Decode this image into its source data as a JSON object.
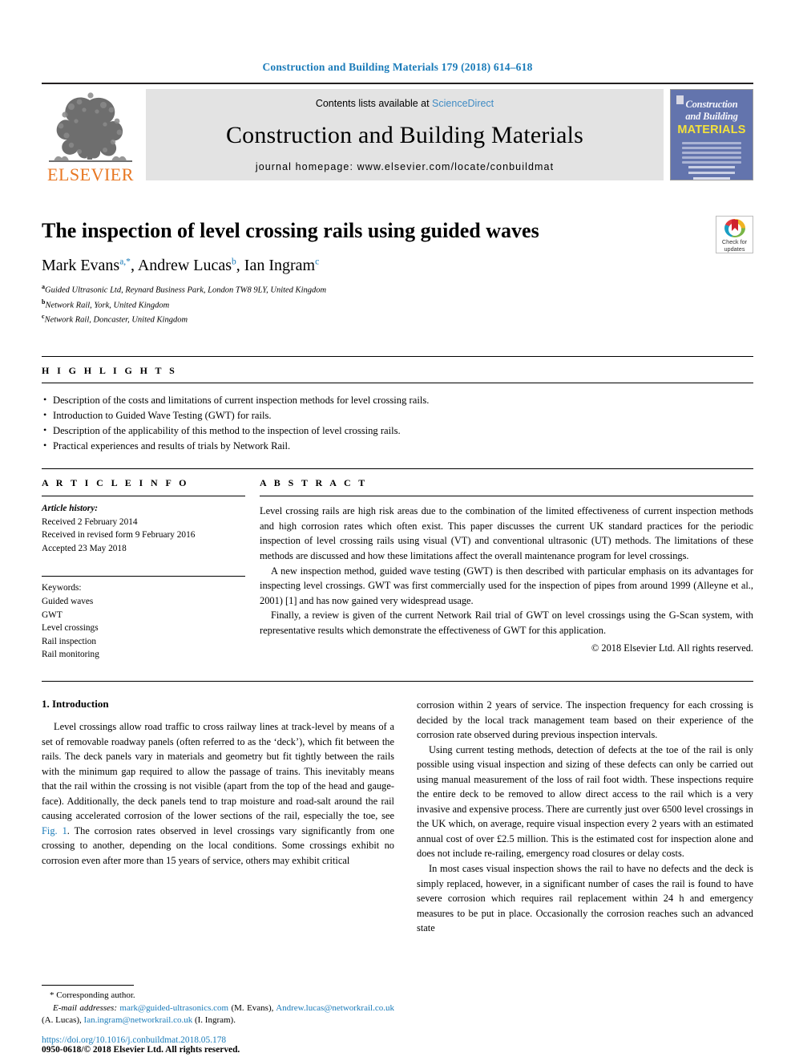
{
  "running_head": "Construction and Building Materials 179 (2018) 614–618",
  "masthead": {
    "publisher": "ELSEVIER",
    "contents_prefix": "Contents lists available at ",
    "contents_link": "ScienceDirect",
    "journal_title": "Construction and Building Materials",
    "homepage_label": "journal homepage: www.elsevier.com/locate/conbuildmat",
    "cover": {
      "line1": "Construction",
      "line2": "and Building",
      "line3": "MATERIALS"
    }
  },
  "article": {
    "title": "The inspection of level crossing rails using guided waves",
    "authors": [
      {
        "name": "Mark Evans",
        "sup": "a,*"
      },
      {
        "name": "Andrew Lucas",
        "sup": "b"
      },
      {
        "name": "Ian Ingram",
        "sup": "c"
      }
    ],
    "affiliations": [
      {
        "sup": "a",
        "text": "Guided Ultrasonic Ltd, Reynard Business Park, London TW8 9LY, United Kingdom"
      },
      {
        "sup": "b",
        "text": "Network Rail, York, United Kingdom"
      },
      {
        "sup": "c",
        "text": "Network Rail, Doncaster, United Kingdom"
      }
    ],
    "crossmark": {
      "line1": "Check for",
      "line2": "updates"
    }
  },
  "highlights": {
    "label": "H I G H L I G H T S",
    "items": [
      "Description of the costs and limitations of current inspection methods for level crossing rails.",
      "Introduction to Guided Wave Testing (GWT) for rails.",
      "Description of the applicability of this method to the inspection of level crossing rails.",
      "Practical experiences and results of trials by Network Rail."
    ]
  },
  "article_info": {
    "label": "A R T I C L E   I N F O",
    "history_label": "Article history:",
    "history": [
      "Received 2 February 2014",
      "Received in revised form 9 February 2016",
      "Accepted 23 May 2018"
    ],
    "keywords_label": "Keywords:",
    "keywords": [
      "Guided waves",
      "GWT",
      "Level crossings",
      "Rail inspection",
      "Rail monitoring"
    ]
  },
  "abstract": {
    "label": "A B S T R A C T",
    "paragraphs": [
      "Level crossing rails are high risk areas due to the combination of the limited effectiveness of current inspection methods and high corrosion rates which often exist. This paper discusses the current UK standard practices for the periodic inspection of level crossing rails using visual (VT) and conventional ultrasonic (UT) methods. The limitations of these methods are discussed and how these limitations affect the overall maintenance program for level crossings.",
      "A new inspection method, guided wave testing (GWT) is then described with particular emphasis on its advantages for inspecting level crossings. GWT was first commercially used for the inspection of pipes from around 1999 (Alleyne et al., 2001) [1] and has now gained very widespread usage.",
      "Finally, a review is given of the current Network Rail trial of GWT on level crossings using the G-Scan system, with representative results which demonstrate the effectiveness of GWT for this application."
    ],
    "copyright": "© 2018 Elsevier Ltd. All rights reserved."
  },
  "body": {
    "section_heading": "1. Introduction",
    "left_paragraphs": [
      "Level crossings allow road traffic to cross railway lines at track-level by means of a set of removable roadway panels (often referred to as the ‘deck’), which fit between the rails. The deck panels vary in materials and geometry but fit tightly between the rails with the minimum gap required to allow the passage of trains. This inevitably means that the rail within the crossing is not visible (apart from the top of the head and gauge-face). Additionally, the deck panels tend to trap moisture and road-salt around the rail causing accelerated corrosion of the lower sections of the rail, especially the toe, see "
    ],
    "left_link": "Fig. 1",
    "left_paragraph_tail": ". The corrosion rates observed in level crossings vary significantly from one crossing to another, depending on the local conditions. Some crossings exhibit no corrosion even after more than 15 years of service, others may exhibit critical",
    "right_paragraphs": [
      "corrosion within 2 years of service. The inspection frequency for each crossing is decided by the local track management team based on their experience of the corrosion rate observed during previous inspection intervals.",
      "Using current testing methods, detection of defects at the toe of the rail is only possible using visual inspection and sizing of these defects can only be carried out using manual measurement of the loss of rail foot width. These inspections require the entire deck to be removed to allow direct access to the rail which is a very invasive and expensive process. There are currently just over 6500 level crossings in the UK which, on average, require visual inspection every 2 years with an estimated annual cost of over £2.5 million. This is the estimated cost for inspection alone and does not include re-railing, emergency road closures or delay costs.",
      "In most cases visual inspection shows the rail to have no defects and the deck is simply replaced, however, in a significant number of cases the rail is found to have severe corrosion which requires rail replacement within 24 h and emergency measures to be put in place. Occasionally the corrosion reaches such an advanced state"
    ]
  },
  "footnote": {
    "corresponding": "* Corresponding author.",
    "email_label": "E-mail addresses:",
    "emails": [
      {
        "address": "mark@guided-ultrasonics.com",
        "owner": "(M. Evans)"
      },
      {
        "address": "Andrew.lucas@networkrail.co.uk",
        "owner": "(A. Lucas)"
      },
      {
        "address": "Ian.ingram@networkrail.co.uk",
        "owner": "(I. Ingram)"
      }
    ]
  },
  "footer": {
    "doi": "https://doi.org/10.1016/j.conbuildmat.2018.05.178",
    "issn_line": "0950-0618/© 2018 Elsevier Ltd. All rights reserved."
  },
  "colors": {
    "link": "#1a7bb9",
    "elsevier_orange": "#E87722",
    "band_gray": "#e3e3e3",
    "cover_blue": "#6374ad",
    "cover_yellow": "#f4e23c"
  }
}
